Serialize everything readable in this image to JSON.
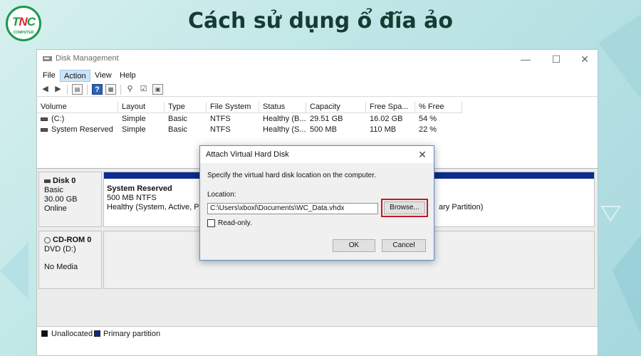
{
  "header": {
    "title": "Cách sử dụng ổ đĩa ảo"
  },
  "logo": {
    "main": "TNC",
    "sub": "COMPUTER"
  },
  "window": {
    "title": "Disk Management",
    "controls": {
      "minimize": "—",
      "maximize": "☐",
      "close": "✕"
    }
  },
  "menu": {
    "items": [
      "File",
      "Action",
      "View",
      "Help"
    ],
    "active": "Action"
  },
  "volumes": {
    "columns": [
      "Volume",
      "Layout",
      "Type",
      "File System",
      "Status",
      "Capacity",
      "Free Spa...",
      "% Free"
    ],
    "rows": [
      [
        "(C:)",
        "Simple",
        "Basic",
        "NTFS",
        "Healthy (B...",
        "29.51 GB",
        "16.02 GB",
        "54 %"
      ],
      [
        "System Reserved",
        "Simple",
        "Basic",
        "NTFS",
        "Healthy (S...",
        "500 MB",
        "110 MB",
        "22 %"
      ]
    ]
  },
  "disks": {
    "disk0": {
      "name": "Disk 0",
      "type": "Basic",
      "size": "30.00 GB",
      "status": "Online",
      "partition": {
        "name": "System Reserved",
        "size": "500 MB NTFS",
        "status": "Healthy (System, Active, Prim"
      },
      "partition2_status_tail": "ary Partition)"
    },
    "cdrom0": {
      "name": "CD-ROM 0",
      "type": "DVD (D:)",
      "status": "No Media"
    }
  },
  "legend": {
    "unallocated": "Unallocated",
    "primary": "Primary partition"
  },
  "dialog": {
    "title": "Attach Virtual Hard Disk",
    "instruction": "Specify the virtual hard disk location on the computer.",
    "location_label": "Location:",
    "location_value": "C:\\Users\\xboxl\\Documents\\WC_Data.vhdx",
    "browse": "Browse...",
    "readonly_label": "Read-only.",
    "ok": "OK",
    "cancel": "Cancel"
  },
  "colors": {
    "headline": "#153b33",
    "highlight": "#c2182b",
    "partition_bar": "#0b2c8c"
  }
}
